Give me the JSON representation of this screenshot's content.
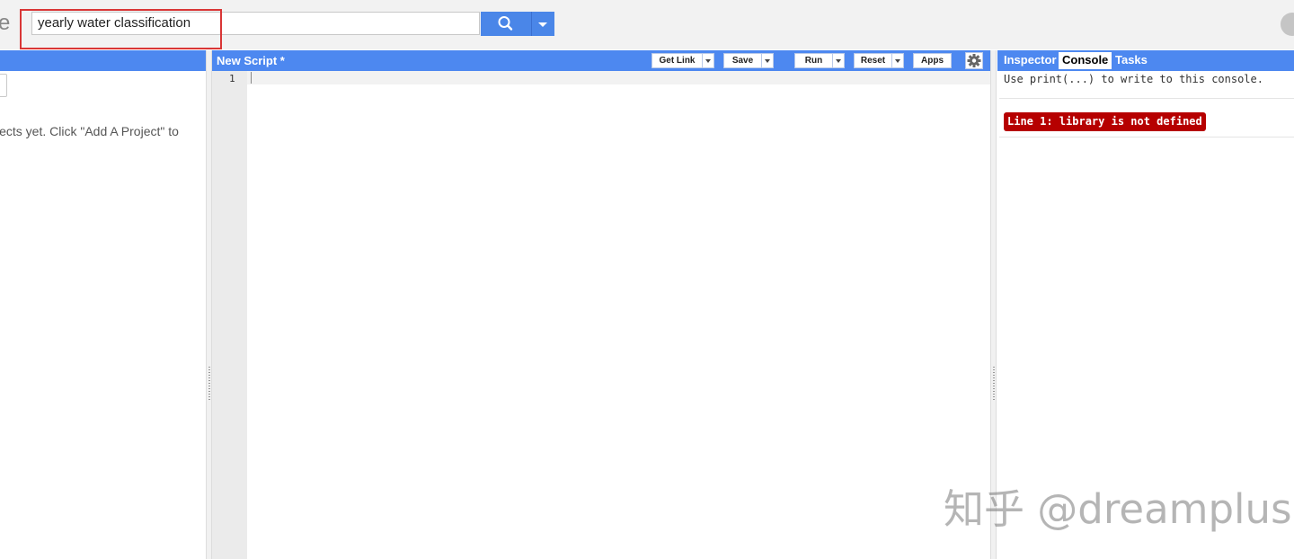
{
  "search": {
    "value": "yearly water classification"
  },
  "left_panel": {
    "message": "jects yet. Click \"Add A Project\" to"
  },
  "editor": {
    "script_title": "New Script *",
    "line_numbers": [
      "1"
    ],
    "toolbar": {
      "get_link": "Get Link",
      "save": "Save",
      "run": "Run",
      "reset": "Reset",
      "apps": "Apps"
    }
  },
  "right_panel": {
    "tabs": [
      "Inspector",
      "Console",
      "Tasks"
    ],
    "active_tab": "Console",
    "console_hint": "Use print(...) to write to this console.",
    "error": "Line 1: library is not defined"
  },
  "watermark": "知乎 @dreamplus",
  "icons": {
    "search": "search-icon",
    "dropdown": "chevron-down-icon",
    "settings": "gear-icon"
  },
  "colors": {
    "accent": "#4d88f0",
    "error": "#b60000",
    "highlight": "#d93636"
  }
}
